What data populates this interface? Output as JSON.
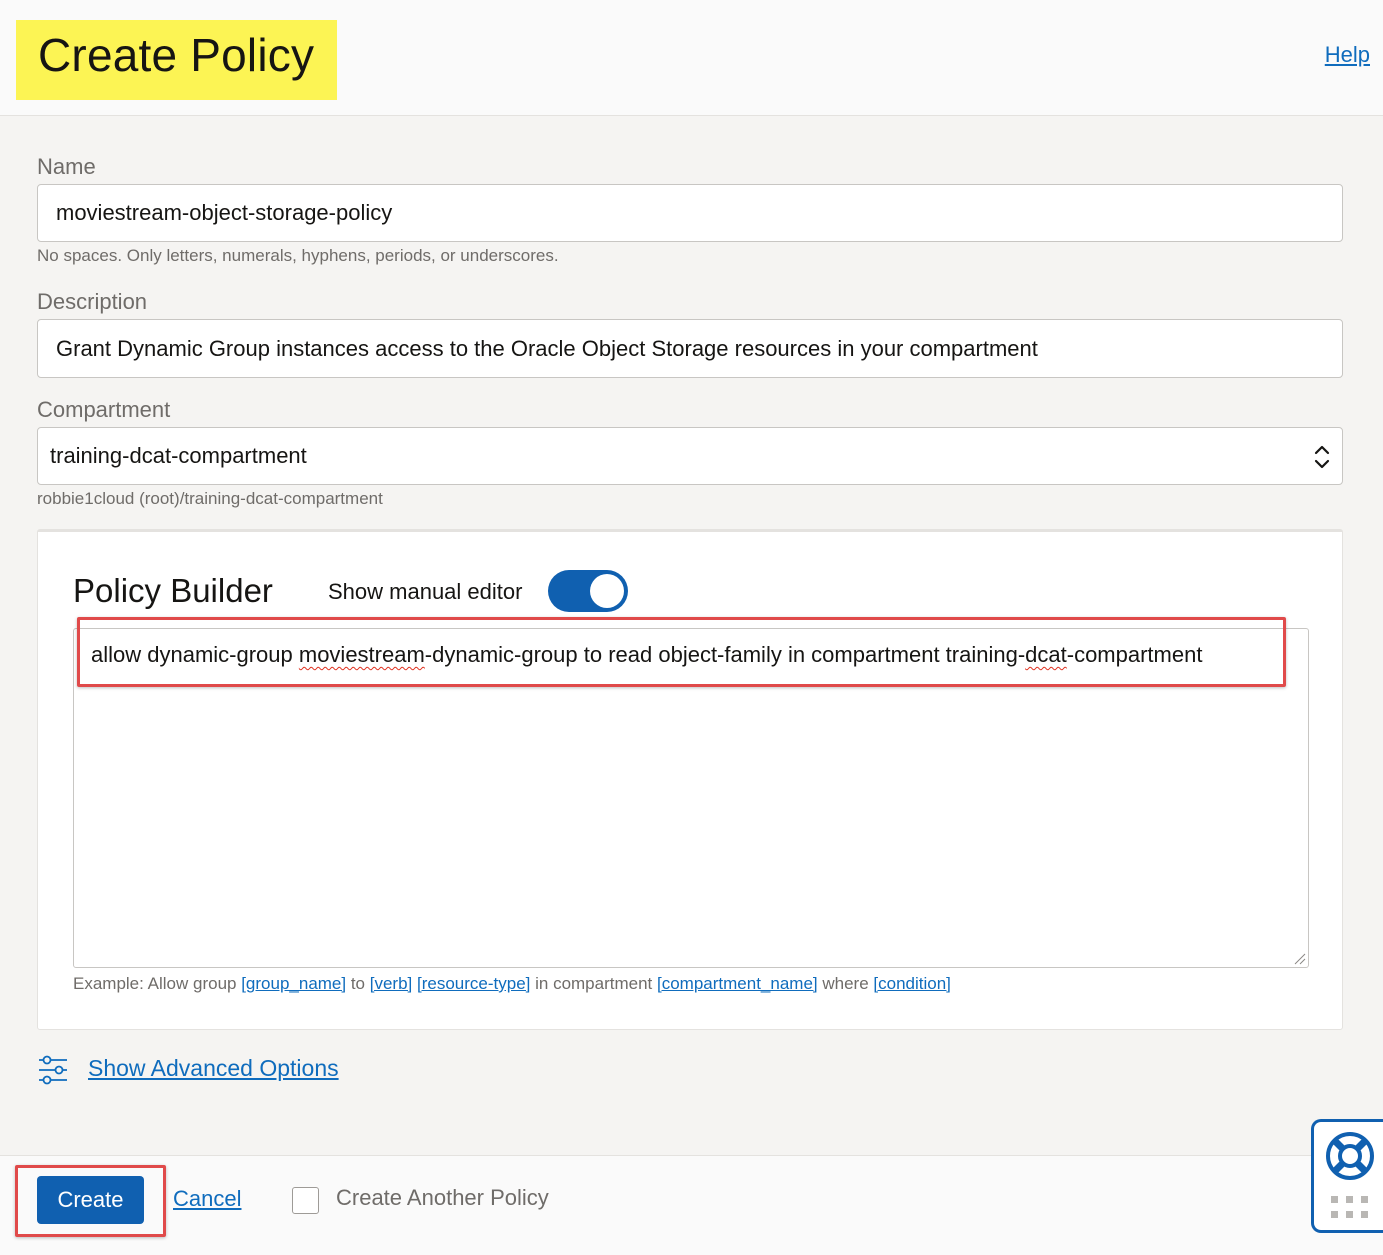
{
  "header": {
    "title": "Create Policy",
    "help_label": "Help"
  },
  "form": {
    "name": {
      "label": "Name",
      "value": "moviestream-object-storage-policy",
      "hint": "No spaces. Only letters, numerals, hyphens, periods, or underscores."
    },
    "description": {
      "label": "Description",
      "value": "Grant Dynamic Group instances access to the Oracle Object Storage resources in your compartment"
    },
    "compartment": {
      "label": "Compartment",
      "value": "training-dcat-compartment",
      "path": "robbie1cloud (root)/training-dcat-compartment"
    }
  },
  "policy_builder": {
    "title": "Policy Builder",
    "toggle_label": "Show manual editor",
    "toggle_on": true,
    "statement": {
      "p1": "allow dynamic-group ",
      "p2": "moviestream",
      "p3": "-dynamic-group to read object-family in compartment training-",
      "p4": "dcat",
      "p5": "-compartment"
    },
    "example": {
      "prefix": "Example: Allow group ",
      "group_name": "[group_name]",
      "to": " to ",
      "verb": "[verb]",
      "resource_type": "[resource-type]",
      "in_compartment": " in compartment ",
      "compartment_name": "[compartment_name]",
      "where": " where ",
      "condition": "[condition]"
    }
  },
  "advanced": {
    "label": "Show Advanced Options"
  },
  "footer": {
    "create_label": "Create",
    "cancel_label": "Cancel",
    "create_another_label": "Create Another Policy",
    "create_another_checked": false
  },
  "colors": {
    "primary": "#1060b0",
    "link": "#0f6cbd",
    "title_highlight": "#fcf454",
    "annotation_red": "#e04a4a"
  },
  "icons": {
    "compartment_select": "chevron-up-down-icon",
    "advanced_options": "sliders-icon",
    "help_widget": "lifebuoy-icon",
    "help_widget_secondary": "grid-dots-icon"
  }
}
